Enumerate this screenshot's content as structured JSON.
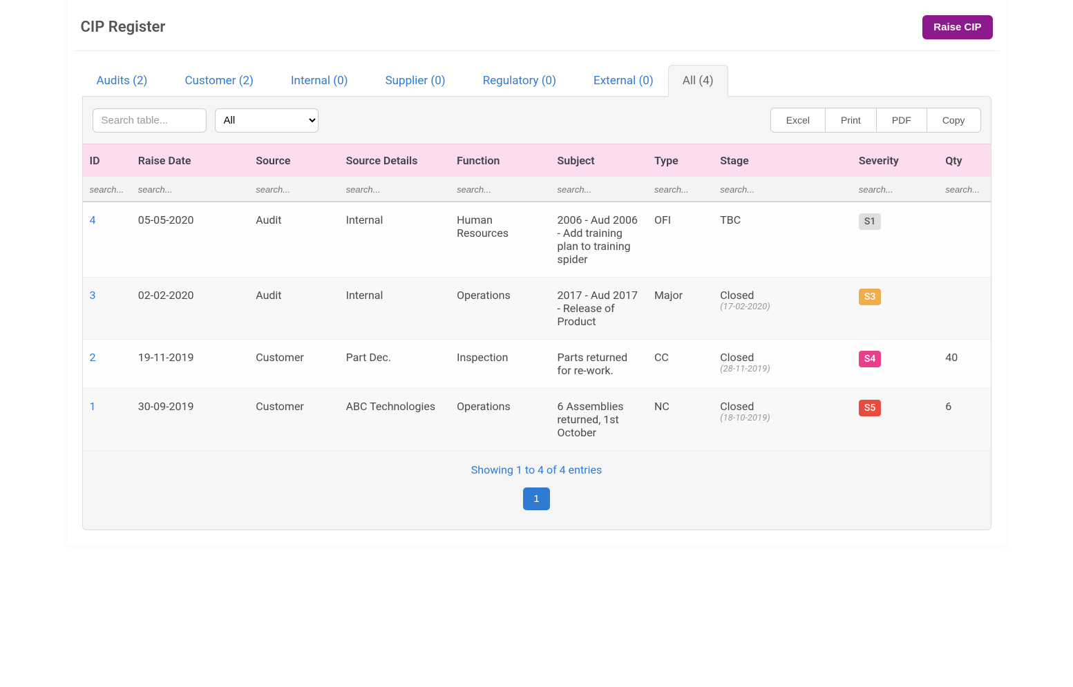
{
  "header": {
    "title": "CIP Register",
    "raise_button": "Raise CIP"
  },
  "tabs": [
    {
      "label": "Audits (2)",
      "active": false
    },
    {
      "label": "Customer (2)",
      "active": false
    },
    {
      "label": "Internal (0)",
      "active": false
    },
    {
      "label": "Supplier (0)",
      "active": false
    },
    {
      "label": "Regulatory (0)",
      "active": false
    },
    {
      "label": "External (0)",
      "active": false
    },
    {
      "label": "All (4)",
      "active": true
    }
  ],
  "toolbar": {
    "search_placeholder": "Search table...",
    "filter_selected": "All",
    "export": {
      "excel": "Excel",
      "print": "Print",
      "pdf": "PDF",
      "copy": "Copy"
    }
  },
  "columns": [
    {
      "key": "id",
      "label": "ID"
    },
    {
      "key": "raise_date",
      "label": "Raise Date"
    },
    {
      "key": "source",
      "label": "Source"
    },
    {
      "key": "source_details",
      "label": "Source Details"
    },
    {
      "key": "function",
      "label": "Function"
    },
    {
      "key": "subject",
      "label": "Subject"
    },
    {
      "key": "type",
      "label": "Type"
    },
    {
      "key": "stage",
      "label": "Stage"
    },
    {
      "key": "severity",
      "label": "Severity"
    },
    {
      "key": "qty",
      "label": "Qty"
    }
  ],
  "column_search_placeholder": "search...",
  "rows": [
    {
      "id": "4",
      "raise_date": "05-05-2020",
      "source": "Audit",
      "source_details": "Internal",
      "function": "Human Resources",
      "subject": "2006 - Aud 2006 - Add training plan to training spider",
      "type": "OFI",
      "stage": "TBC",
      "stage_date": "",
      "severity": "S1",
      "severity_bg": "#dedede",
      "severity_fg": "#555555",
      "qty": ""
    },
    {
      "id": "3",
      "raise_date": "02-02-2020",
      "source": "Audit",
      "source_details": "Internal",
      "function": "Operations",
      "subject": "2017 - Aud 2017 - Release of Product",
      "type": "Major",
      "stage": "Closed",
      "stage_date": "(17-02-2020)",
      "severity": "S3",
      "severity_bg": "#f0ad4e",
      "severity_fg": "#ffffff",
      "qty": ""
    },
    {
      "id": "2",
      "raise_date": "19-11-2019",
      "source": "Customer",
      "source_details": "Part Dec.",
      "function": "Inspection",
      "subject": "Parts returned for re-work.",
      "type": "CC",
      "stage": "Closed",
      "stage_date": "(28-11-2019)",
      "severity": "S4",
      "severity_bg": "#e83e8c",
      "severity_fg": "#ffffff",
      "qty": "40"
    },
    {
      "id": "1",
      "raise_date": "30-09-2019",
      "source": "Customer",
      "source_details": "ABC Technologies",
      "function": "Operations",
      "subject": "6 Assemblies returned, 1st October",
      "type": "NC",
      "stage": "Closed",
      "stage_date": "(18-10-2019)",
      "severity": "S5",
      "severity_bg": "#e74c3c",
      "severity_fg": "#ffffff",
      "qty": "6"
    }
  ],
  "footer": {
    "info": "Showing 1 to 4 of 4 entries",
    "page": "1"
  }
}
